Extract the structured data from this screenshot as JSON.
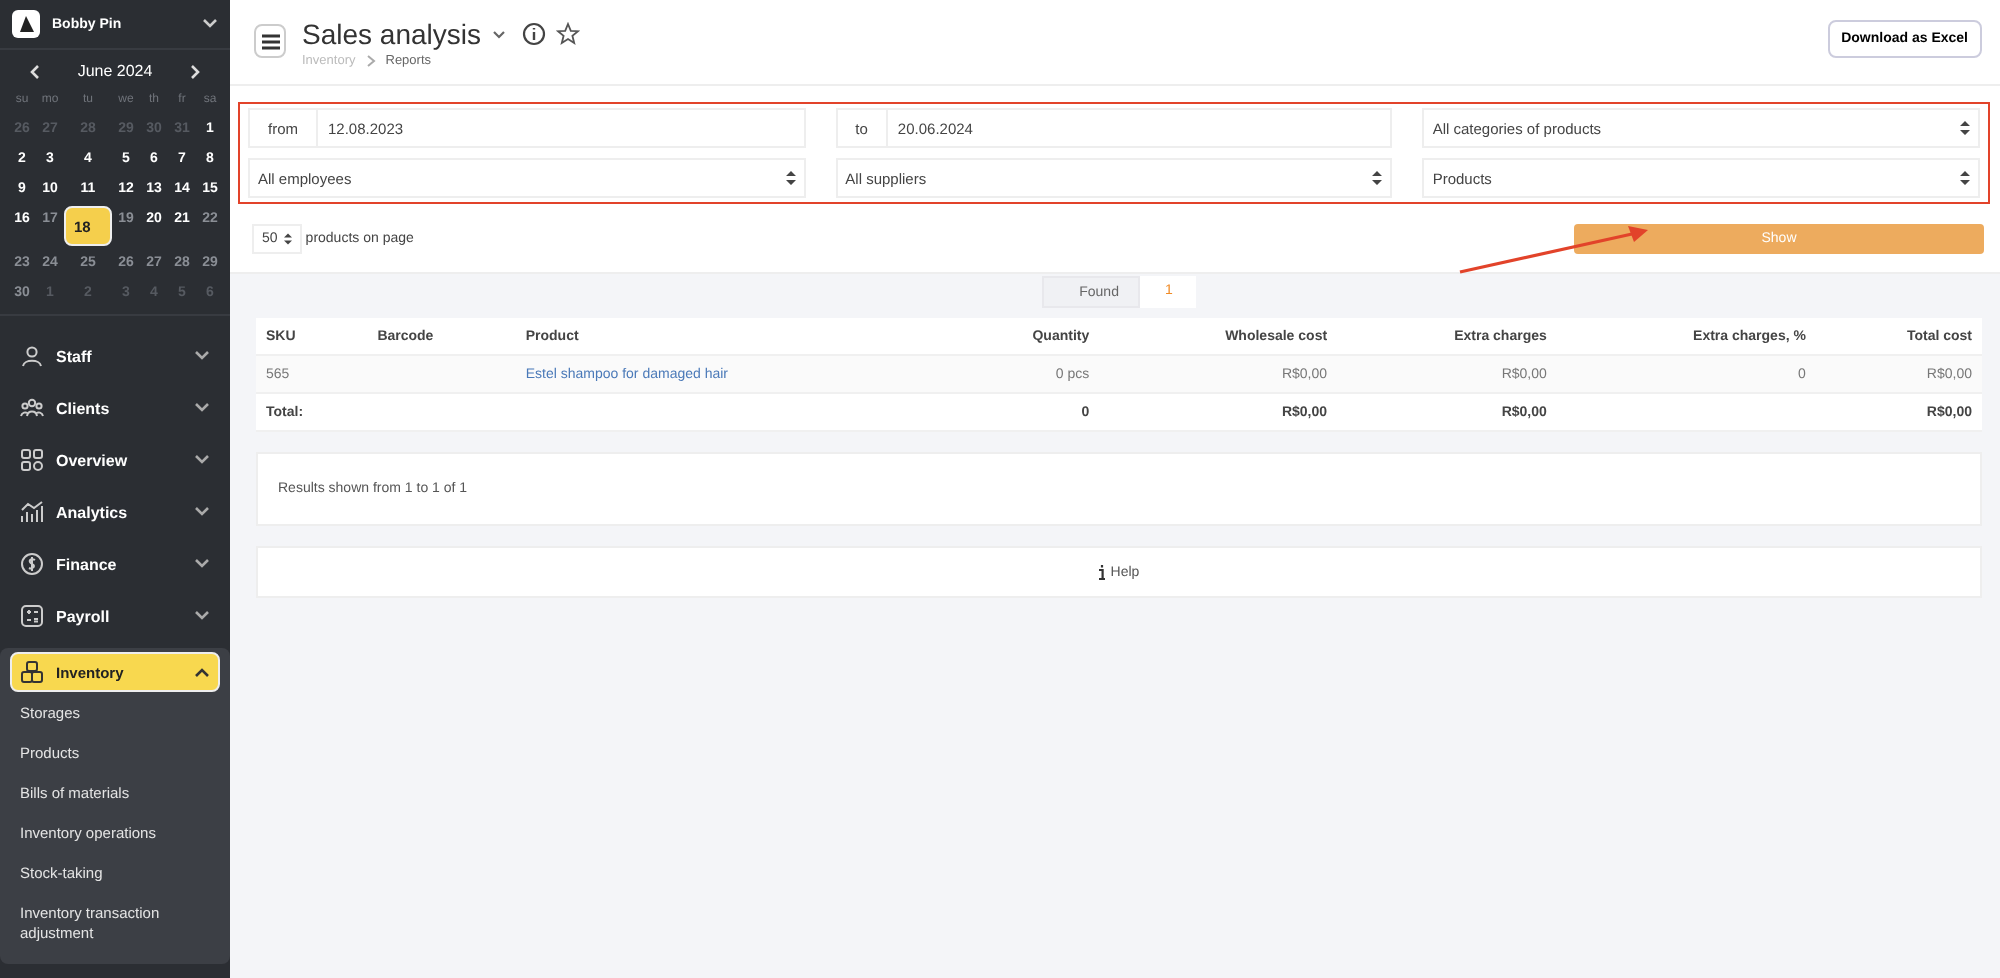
{
  "account": {
    "name": "Bobby Pin"
  },
  "calendar": {
    "month": "June 2024",
    "weekdays": [
      "su",
      "mo",
      "tu",
      "we",
      "th",
      "fr",
      "sa"
    ],
    "weeks": [
      [
        {
          "d": "26",
          "in_month": false,
          "available": false,
          "selected": false
        },
        {
          "d": "27",
          "in_month": false,
          "available": false,
          "selected": false
        },
        {
          "d": "28",
          "in_month": false,
          "available": false,
          "selected": false
        },
        {
          "d": "29",
          "in_month": false,
          "available": false,
          "selected": false
        },
        {
          "d": "30",
          "in_month": false,
          "available": false,
          "selected": false
        },
        {
          "d": "31",
          "in_month": false,
          "available": false,
          "selected": false
        },
        {
          "d": "1",
          "in_month": true,
          "available": true,
          "selected": false
        }
      ],
      [
        {
          "d": "2",
          "in_month": true,
          "available": true,
          "selected": false
        },
        {
          "d": "3",
          "in_month": true,
          "available": true,
          "selected": false
        },
        {
          "d": "4",
          "in_month": true,
          "available": true,
          "selected": false
        },
        {
          "d": "5",
          "in_month": true,
          "available": true,
          "selected": false
        },
        {
          "d": "6",
          "in_month": true,
          "available": true,
          "selected": false
        },
        {
          "d": "7",
          "in_month": true,
          "available": true,
          "selected": false
        },
        {
          "d": "8",
          "in_month": true,
          "available": true,
          "selected": false
        }
      ],
      [
        {
          "d": "9",
          "in_month": true,
          "available": true,
          "selected": false
        },
        {
          "d": "10",
          "in_month": true,
          "available": true,
          "selected": false
        },
        {
          "d": "11",
          "in_month": true,
          "available": true,
          "selected": false
        },
        {
          "d": "12",
          "in_month": true,
          "available": true,
          "selected": false
        },
        {
          "d": "13",
          "in_month": true,
          "available": true,
          "selected": false
        },
        {
          "d": "14",
          "in_month": true,
          "available": true,
          "selected": false
        },
        {
          "d": "15",
          "in_month": true,
          "available": true,
          "selected": false
        }
      ],
      [
        {
          "d": "16",
          "in_month": true,
          "available": true,
          "selected": false
        },
        {
          "d": "17",
          "in_month": true,
          "available": false,
          "selected": false
        },
        {
          "d": "18",
          "in_month": true,
          "available": true,
          "selected": true
        },
        {
          "d": "19",
          "in_month": true,
          "available": false,
          "selected": false
        },
        {
          "d": "20",
          "in_month": true,
          "available": true,
          "selected": false
        },
        {
          "d": "21",
          "in_month": true,
          "available": true,
          "selected": false
        },
        {
          "d": "22",
          "in_month": true,
          "available": false,
          "selected": false
        }
      ],
      [
        {
          "d": "23",
          "in_month": true,
          "available": false,
          "selected": false
        },
        {
          "d": "24",
          "in_month": true,
          "available": false,
          "selected": false
        },
        {
          "d": "25",
          "in_month": true,
          "available": false,
          "selected": false
        },
        {
          "d": "26",
          "in_month": true,
          "available": false,
          "selected": false
        },
        {
          "d": "27",
          "in_month": true,
          "available": false,
          "selected": false
        },
        {
          "d": "28",
          "in_month": true,
          "available": false,
          "selected": false
        },
        {
          "d": "29",
          "in_month": true,
          "available": false,
          "selected": false
        }
      ],
      [
        {
          "d": "30",
          "in_month": true,
          "available": false,
          "selected": false
        },
        {
          "d": "1",
          "in_month": false,
          "available": false,
          "selected": false
        },
        {
          "d": "2",
          "in_month": false,
          "available": false,
          "selected": false
        },
        {
          "d": "3",
          "in_month": false,
          "available": false,
          "selected": false
        },
        {
          "d": "4",
          "in_month": false,
          "available": false,
          "selected": false
        },
        {
          "d": "5",
          "in_month": false,
          "available": false,
          "selected": false
        },
        {
          "d": "6",
          "in_month": false,
          "available": false,
          "selected": false
        }
      ]
    ]
  },
  "sidebar": {
    "items": [
      {
        "label": "Staff",
        "selected": false,
        "expanded": false
      },
      {
        "label": "Clients",
        "selected": false,
        "expanded": false
      },
      {
        "label": "Overview",
        "selected": false,
        "expanded": false
      },
      {
        "label": "Analytics",
        "selected": false,
        "expanded": false
      },
      {
        "label": "Finance",
        "selected": false,
        "expanded": false
      },
      {
        "label": "Payroll",
        "selected": false,
        "expanded": false
      },
      {
        "label": "Inventory",
        "selected": true,
        "expanded": true,
        "children": [
          {
            "label": "Storages"
          },
          {
            "label": "Products"
          },
          {
            "label": "Bills of materials"
          },
          {
            "label": "Inventory operations"
          },
          {
            "label": "Stock-taking"
          },
          {
            "label": "Inventory transaction adjustment"
          }
        ]
      }
    ]
  },
  "header": {
    "title": "Sales analysis",
    "breadcrumbs": [
      "Inventory",
      "Reports"
    ],
    "export_button": "Download as Excel"
  },
  "filters": {
    "from_label": "from",
    "from_value": "12.08.2023",
    "to_label": "to",
    "to_value": "20.06.2024",
    "category": "All categories of products",
    "employee": "All employees",
    "supplier": "All suppliers",
    "group": "Products"
  },
  "page_size": {
    "value": "50",
    "label": "products on page"
  },
  "show_button": "Show",
  "found": {
    "label": "Found",
    "count": "1"
  },
  "table": {
    "columns": [
      "SKU",
      "Barcode",
      "Product",
      "Quantity",
      "Wholesale cost",
      "Extra charges",
      "Extra charges, %",
      "Total cost"
    ],
    "rows": [
      {
        "sku": "565",
        "product": "Estel shampoo for damaged hair",
        "quantity": "0 pcs",
        "wholesale": "R$0,00",
        "extra": "R$0,00",
        "extra_pct": "0",
        "total": "R$0,00"
      }
    ],
    "totals": {
      "label": "Total:",
      "quantity": "0",
      "wholesale": "R$0,00",
      "extra": "R$0,00",
      "total": "R$0,00"
    }
  },
  "results_text": "Results shown from 1 to 1 of 1",
  "help": "Help"
}
